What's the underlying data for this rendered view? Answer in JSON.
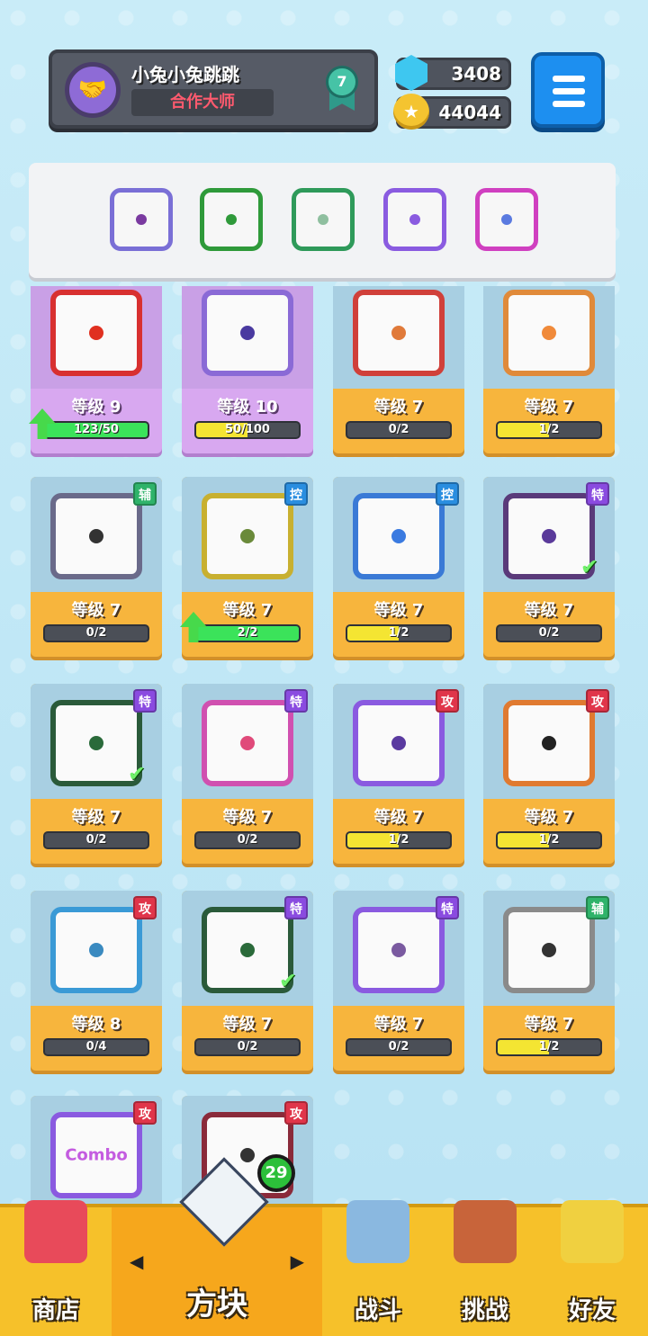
{
  "header": {
    "player_name": "小兔小兔跳跳",
    "player_title": "合作大师",
    "rank_level": "7",
    "gems": "3408",
    "coins": "44044"
  },
  "equipped": [
    {
      "color": "#7a6fd6",
      "dot": "#7a3aa0"
    },
    {
      "color": "#2f9a3a",
      "dot": "#2f9a3a"
    },
    {
      "color": "#2f9a5a",
      "dot": "#8fbf9f"
    },
    {
      "color": "#8a5be0",
      "dot": "#8a5be0"
    },
    {
      "color": "#d040c0",
      "dot": "#5a7ae0"
    }
  ],
  "cards": [
    {
      "tag": "",
      "tag_type": "",
      "level": "等级 9",
      "progress": "123/50",
      "fill": 1.0,
      "fill_color": "green",
      "up": true,
      "purple": true,
      "frame": "#d83030",
      "dot": "#e03020",
      "check": false
    },
    {
      "tag": "",
      "tag_type": "",
      "level": "等级 10",
      "progress": "50/100",
      "fill": 0.5,
      "fill_color": "yellow",
      "up": false,
      "purple": true,
      "frame": "#8a6ad6",
      "dot": "#4a3aa0",
      "check": false
    },
    {
      "tag": "",
      "tag_type": "",
      "level": "等级 7",
      "progress": "0/2",
      "fill": 0,
      "fill_color": "yellow",
      "up": false,
      "purple": false,
      "frame": "#d0403a",
      "dot": "#e07a3a",
      "check": false
    },
    {
      "tag": "",
      "tag_type": "",
      "level": "等级 7",
      "progress": "1/2",
      "fill": 0.5,
      "fill_color": "yellow",
      "up": false,
      "purple": false,
      "frame": "#e08a3a",
      "dot": "#f08a3a",
      "check": false
    },
    {
      "tag": "辅",
      "tag_type": "fu",
      "level": "等级 7",
      "progress": "0/2",
      "fill": 0,
      "fill_color": "yellow",
      "up": false,
      "purple": false,
      "frame": "#6a6a8a",
      "dot": "#333333",
      "check": false
    },
    {
      "tag": "控",
      "tag_type": "kong",
      "level": "等级 7",
      "progress": "2/2",
      "fill": 1.0,
      "fill_color": "green",
      "up": true,
      "purple": false,
      "frame": "#c8b030",
      "dot": "#6a8a3a",
      "check": false
    },
    {
      "tag": "控",
      "tag_type": "kong",
      "level": "等级 7",
      "progress": "1/2",
      "fill": 0.5,
      "fill_color": "yellow",
      "up": false,
      "purple": false,
      "frame": "#3a7ad6",
      "dot": "#3a7ae0",
      "check": false
    },
    {
      "tag": "特",
      "tag_type": "te",
      "level": "等级 7",
      "progress": "0/2",
      "fill": 0,
      "fill_color": "yellow",
      "up": false,
      "purple": false,
      "frame": "#5a3a7a",
      "dot": "#5a3a9a",
      "check": true
    },
    {
      "tag": "特",
      "tag_type": "te",
      "level": "等级 7",
      "progress": "0/2",
      "fill": 0,
      "fill_color": "yellow",
      "up": false,
      "purple": false,
      "frame": "#2a5a3a",
      "dot": "#2a6a3a",
      "check": true
    },
    {
      "tag": "特",
      "tag_type": "te",
      "level": "等级 7",
      "progress": "0/2",
      "fill": 0,
      "fill_color": "yellow",
      "up": false,
      "purple": false,
      "frame": "#d050b0",
      "dot": "#e04a7a",
      "check": false
    },
    {
      "tag": "攻",
      "tag_type": "gong",
      "level": "等级 7",
      "progress": "1/2",
      "fill": 0.5,
      "fill_color": "yellow",
      "up": false,
      "purple": false,
      "frame": "#8a5ae0",
      "dot": "#5a3aa0",
      "check": false
    },
    {
      "tag": "攻",
      "tag_type": "gong",
      "level": "等级 7",
      "progress": "1/2",
      "fill": 0.5,
      "fill_color": "yellow",
      "up": false,
      "purple": false,
      "frame": "#e07a30",
      "dot": "#222222",
      "check": false
    },
    {
      "tag": "攻",
      "tag_type": "gong",
      "level": "等级 8",
      "progress": "0/4",
      "fill": 0,
      "fill_color": "yellow",
      "up": false,
      "purple": false,
      "frame": "#3a9ad6",
      "dot": "#3a8ac0",
      "check": false
    },
    {
      "tag": "特",
      "tag_type": "te",
      "level": "等级 7",
      "progress": "0/2",
      "fill": 0,
      "fill_color": "yellow",
      "up": false,
      "purple": false,
      "frame": "#2a5a3a",
      "dot": "#2a6a3a",
      "check": true
    },
    {
      "tag": "特",
      "tag_type": "te",
      "level": "等级 7",
      "progress": "0/2",
      "fill": 0,
      "fill_color": "yellow",
      "up": false,
      "purple": false,
      "frame": "#8a5ae0",
      "dot": "#7a5aa0",
      "check": false
    },
    {
      "tag": "辅",
      "tag_type": "fu",
      "level": "等级 7",
      "progress": "1/2",
      "fill": 0.5,
      "fill_color": "yellow",
      "up": false,
      "purple": false,
      "frame": "#8a8a8a",
      "dot": "#333333",
      "check": false
    },
    {
      "tag": "攻",
      "tag_type": "gong",
      "level": "",
      "progress": "",
      "fill": 0,
      "fill_color": "yellow",
      "up": false,
      "purple": false,
      "frame": "#8a5ae0",
      "dot": "",
      "check": false,
      "combo": "Combo"
    },
    {
      "tag": "攻",
      "tag_type": "gong",
      "level": "",
      "progress": "",
      "fill": 0,
      "fill_color": "yellow",
      "up": false,
      "purple": false,
      "frame": "#8a2a3a",
      "dot": "#333333",
      "check": false
    }
  ],
  "nav": {
    "shop": "商店",
    "blocks": "方块",
    "battle": "战斗",
    "challenge": "挑战",
    "friends": "好友",
    "blocks_badge": "29"
  }
}
